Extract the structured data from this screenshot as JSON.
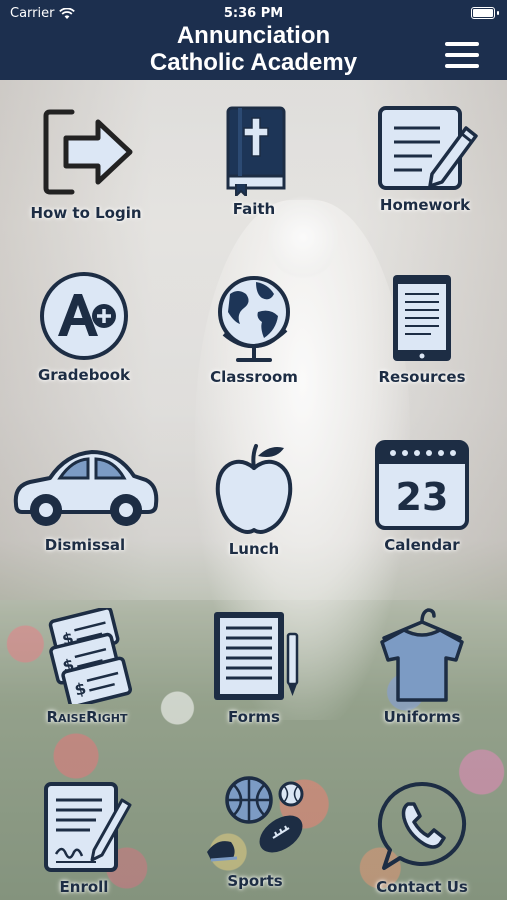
{
  "status_bar": {
    "carrier": "Carrier",
    "time": "5:36 PM"
  },
  "header": {
    "title_line1": "Annunciation",
    "title_line2": "Catholic Academy",
    "menu_icon": "hamburger-menu-icon"
  },
  "colors": {
    "header_bg": "#1c2f4e",
    "icon_fill": "#dce7f5",
    "icon_stroke": "#1d2d44",
    "label": "#1d2d44"
  },
  "tiles": [
    {
      "label": "How to Login",
      "icon": "login-arrow-icon"
    },
    {
      "label": "Faith",
      "icon": "bible-cross-icon"
    },
    {
      "label": "Homework",
      "icon": "notebook-pencil-icon"
    },
    {
      "label": "Gradebook",
      "icon": "a-plus-grade-icon"
    },
    {
      "label": "Classroom",
      "icon": "globe-icon"
    },
    {
      "label": "Resources",
      "icon": "tablet-document-icon"
    },
    {
      "label": "Dismissal",
      "icon": "car-icon"
    },
    {
      "label": "Lunch",
      "icon": "apple-icon"
    },
    {
      "label": "Calendar",
      "icon": "calendar-icon",
      "day": "23"
    },
    {
      "label": "RaiseRight",
      "icon": "gift-cards-icon"
    },
    {
      "label": "Forms",
      "icon": "document-pen-icon"
    },
    {
      "label": "Uniforms",
      "icon": "shirt-hanger-icon"
    },
    {
      "label": "Enroll",
      "icon": "signature-document-icon"
    },
    {
      "label": "Sports",
      "icon": "sports-balls-icon"
    },
    {
      "label": "Contact Us",
      "icon": "phone-bubble-icon"
    }
  ]
}
